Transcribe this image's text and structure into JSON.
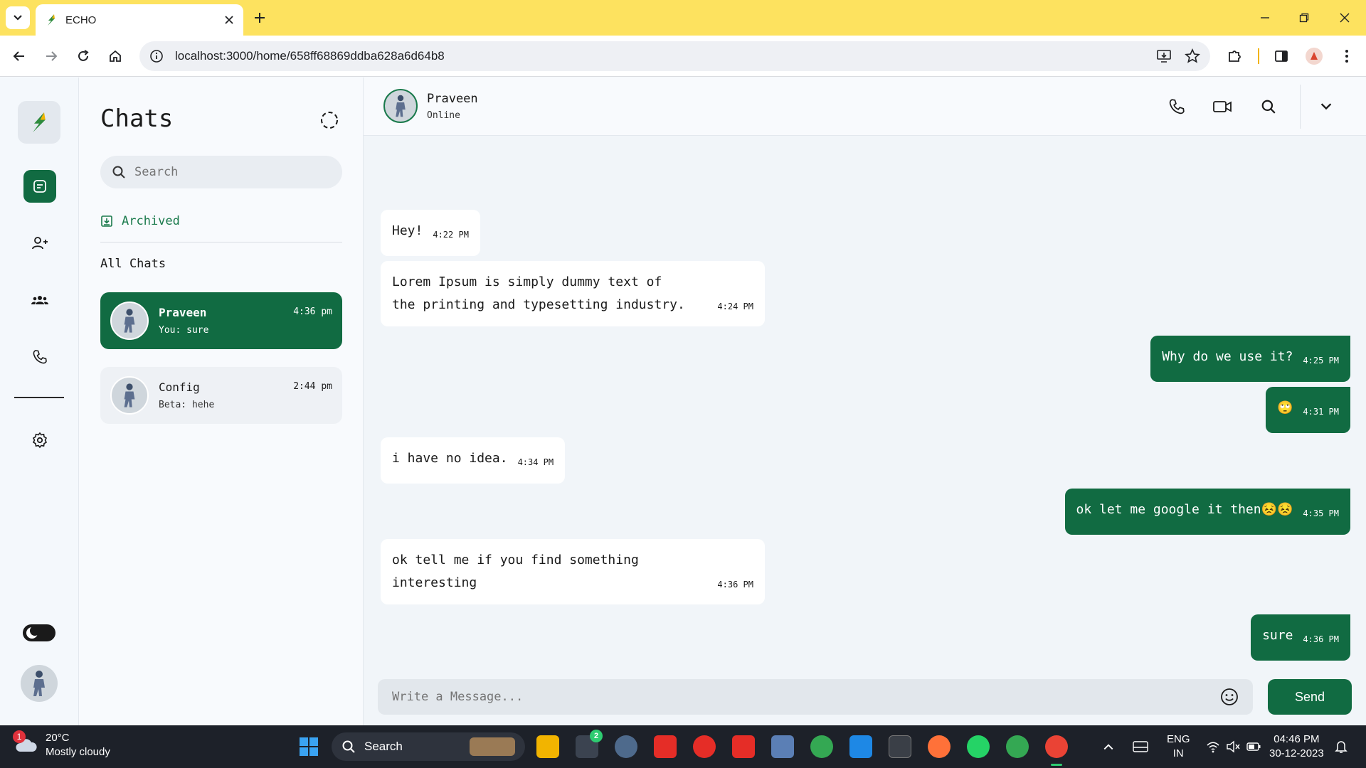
{
  "browser": {
    "tab_title": "ECHO",
    "url": "localhost:3000/home/658ff68869ddba628a6d64b8"
  },
  "colors": {
    "brand_green": "#116b42",
    "tab_bar_yellow": "#fde25f"
  },
  "rail": {
    "items": [
      "logo-icon",
      "chat-icon",
      "add-user-icon",
      "group-icon",
      "phone-icon",
      "gear-icon",
      "theme-toggle",
      "avatar"
    ]
  },
  "chatlist": {
    "title": "Chats",
    "search_placeholder": "Search",
    "archived_label": "Archived",
    "all_chats_label": "All Chats",
    "items": [
      {
        "name": "Praveen",
        "last_message": "You: sure",
        "time": "4:36 pm",
        "active": true
      },
      {
        "name": "Config",
        "last_message": "Beta: hehe",
        "time": "2:44 pm",
        "active": false
      }
    ]
  },
  "conversation": {
    "contact_name": "Praveen",
    "status": "Online",
    "messages": [
      {
        "direction": "in",
        "text": "Hey!",
        "time": "4:22 PM"
      },
      {
        "direction": "in",
        "text": "Lorem Ipsum is simply dummy text of the printing and typesetting industry.",
        "time": "4:24 PM"
      },
      {
        "direction": "out",
        "text": "Why do we use it?",
        "time": "4:25 PM"
      },
      {
        "direction": "out",
        "text": "🙄",
        "time": "4:31 PM"
      },
      {
        "direction": "in",
        "text": "i have no idea.",
        "time": "4:34 PM"
      },
      {
        "direction": "out",
        "text": "ok let me google it then😣😣",
        "time": "4:35 PM"
      },
      {
        "direction": "in",
        "text": "ok tell me if you find something interesting",
        "time": "4:36 PM"
      },
      {
        "direction": "out",
        "text": "sure",
        "time": "4:36 PM"
      }
    ],
    "composer_placeholder": "Write a Message...",
    "send_label": "Send"
  },
  "taskbar": {
    "weather_temp": "20°C",
    "weather_desc": "Mostly cloudy",
    "weather_badge": "1",
    "search_label": "Search",
    "notification_badge": "2",
    "language_line1": "ENG",
    "language_line2": "IN",
    "time": "04:46 PM",
    "date": "30-12-2023"
  }
}
